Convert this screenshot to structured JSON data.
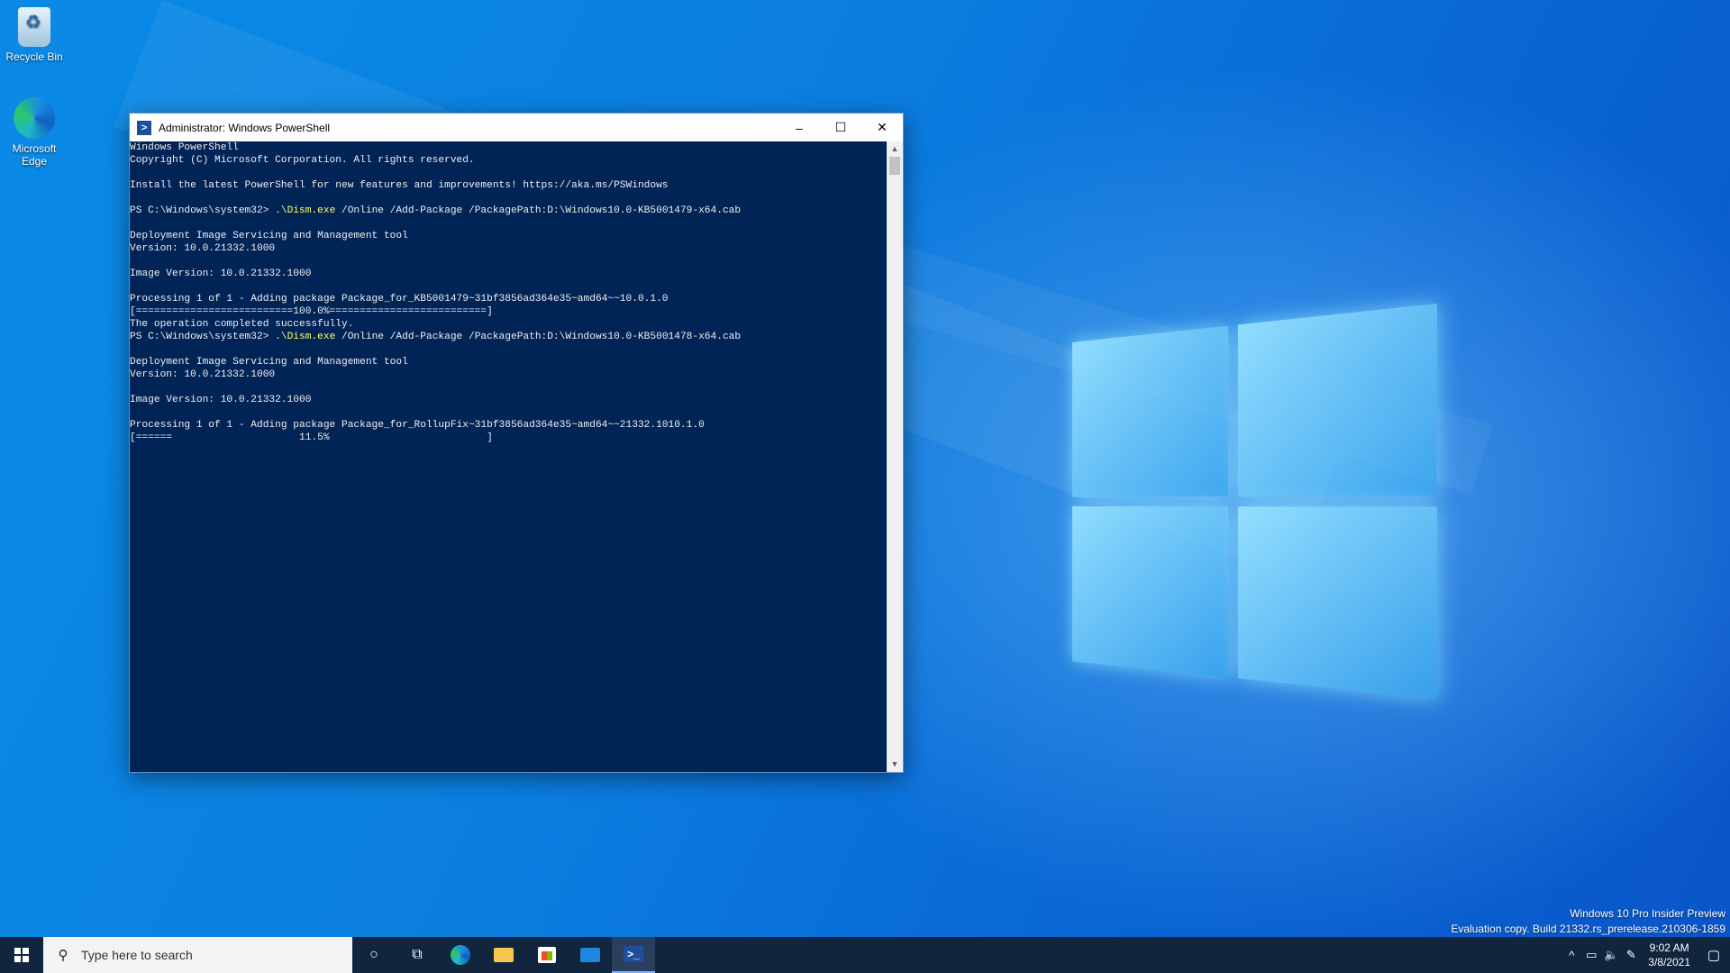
{
  "desktop": {
    "icons": [
      {
        "label": "Recycle Bin"
      },
      {
        "label": "Microsoft Edge"
      }
    ]
  },
  "window": {
    "title": "Administrator: Windows PowerShell",
    "controls": {
      "minimize": "–",
      "maximize": "☐",
      "close": "✕"
    }
  },
  "console": {
    "lines": [
      {
        "text": "Windows PowerShell"
      },
      {
        "text": "Copyright (C) Microsoft Corporation. All rights reserved."
      },
      {
        "text": ""
      },
      {
        "text": "Install the latest PowerShell for new features and improvements! https://aka.ms/PSWindows"
      },
      {
        "text": ""
      },
      {
        "prompt": "PS C:\\Windows\\system32> ",
        "cmd": ".\\Dism.exe",
        "args": " /Online /Add-Package /PackagePath:D:\\Windows10.0-KB5001479-x64.cab"
      },
      {
        "text": ""
      },
      {
        "text": "Deployment Image Servicing and Management tool"
      },
      {
        "text": "Version: 10.0.21332.1000"
      },
      {
        "text": ""
      },
      {
        "text": "Image Version: 10.0.21332.1000"
      },
      {
        "text": ""
      },
      {
        "text": "Processing 1 of 1 - Adding package Package_for_KB5001479~31bf3856ad364e35~amd64~~10.0.1.0"
      },
      {
        "text": "[==========================100.0%==========================]"
      },
      {
        "text": "The operation completed successfully."
      },
      {
        "prompt": "PS C:\\Windows\\system32> ",
        "cmd": ".\\Dism.exe",
        "args": " /Online /Add-Package /PackagePath:D:\\Windows10.0-KB5001478-x64.cab"
      },
      {
        "text": ""
      },
      {
        "text": "Deployment Image Servicing and Management tool"
      },
      {
        "text": "Version: 10.0.21332.1000"
      },
      {
        "text": ""
      },
      {
        "text": "Image Version: 10.0.21332.1000"
      },
      {
        "text": ""
      },
      {
        "text": "Processing 1 of 1 - Adding package Package_for_RollupFix~31bf3856ad364e35~amd64~~21332.1010.1.0"
      },
      {
        "text": "[======                     11.5%                          ]"
      }
    ]
  },
  "watermark": {
    "line1": "Windows 10 Pro Insider Preview",
    "line2": "Evaluation copy. Build 21332.rs_prerelease.210306-1859"
  },
  "taskbar": {
    "search_placeholder": "Type here to search",
    "clock": {
      "time": "9:02 AM",
      "date": "3/8/2021"
    }
  }
}
